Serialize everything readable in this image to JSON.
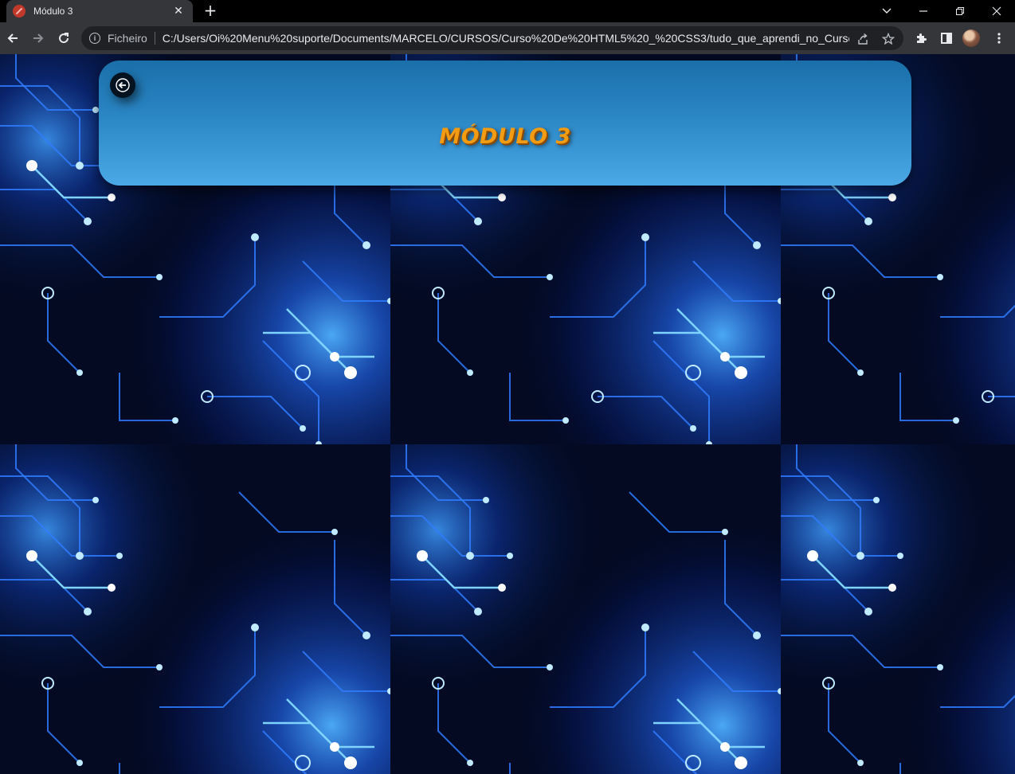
{
  "browser": {
    "tab": {
      "title": "Módulo 3",
      "close_glyph": "✕",
      "favicon": "file-favicon"
    },
    "new_tab_glyph": "+",
    "window_controls": {
      "tab_search": "chevron-down-icon",
      "minimize": "minimize-icon",
      "restore": "restore-icon",
      "close": "close-icon"
    },
    "nav": {
      "back": "back-arrow-icon",
      "forward": "forward-arrow-icon",
      "reload": "reload-icon"
    },
    "omnibox": {
      "info_glyph": "i",
      "scheme_label": "Ficheiro",
      "url": "C:/Users/Oi%20Menu%20suporte/Documents/MARCELO/CURSOS/Curso%20De%20HTML5%20_%20CSS3/tudo_que_aprendi_no_Curso/m...",
      "actions": [
        "share-icon",
        "star-icon"
      ]
    },
    "toolbar_actions": [
      "extensions-icon",
      "side-panel-icon",
      "profile-avatar",
      "menu-kebab-icon"
    ]
  },
  "page": {
    "header": {
      "title": "MÓDULO 3",
      "back_button_icon": "arrow-left-icon"
    },
    "background": "circuit-board-tiles",
    "colors": {
      "header_top": "#1a6fa9",
      "header_bottom": "#4aa9e6",
      "title": "#f39c12",
      "background": "#020615"
    }
  }
}
